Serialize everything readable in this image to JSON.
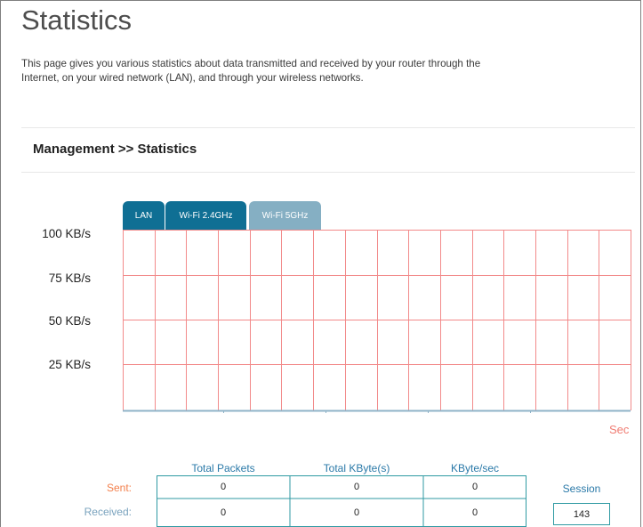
{
  "page": {
    "title": "Statistics",
    "description": "This page gives you various statistics about data transmitted and received by your router through the Internet, on your wired network (LAN), and through your wireless networks."
  },
  "section": {
    "title": "Management >> Statistics"
  },
  "tabs": [
    {
      "label": "LAN",
      "active": true
    },
    {
      "label": "Wi-Fi 2.4GHz",
      "active": false
    },
    {
      "label": "Wi-Fi 5GHz",
      "active": false
    }
  ],
  "chart": {
    "y_labels": [
      "100 KB/s",
      "75 KB/s",
      "50 KB/s",
      "25 KB/s"
    ],
    "x_unit": "Sec",
    "grid_color": "#f28a8a",
    "axis_color": "#8fb3c8"
  },
  "table": {
    "columns": [
      "Total Packets",
      "Total KByte(s)",
      "KByte/sec"
    ],
    "rows": [
      {
        "label": "Sent:",
        "values": [
          "0",
          "0",
          "0"
        ]
      },
      {
        "label": "Received:",
        "values": [
          "0",
          "0",
          "0"
        ]
      }
    ],
    "session_label": "Session",
    "session_value": "143"
  },
  "colors": {
    "tab_active": "#0f6f94",
    "tab_inactive": "#85afc3",
    "sent": "#f3804d",
    "received": "#7aa3be",
    "header_text": "#2a79a8",
    "table_border": "#2f9aa3"
  }
}
